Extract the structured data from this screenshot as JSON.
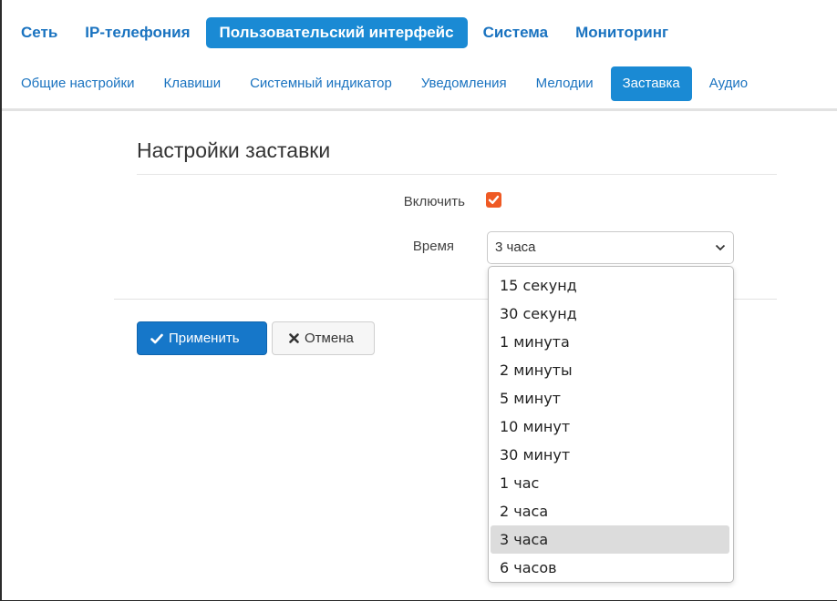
{
  "topnav": {
    "tabs": [
      {
        "label": "Сеть",
        "active": false
      },
      {
        "label": "IP-телефония",
        "active": false
      },
      {
        "label": "Пользовательский интерфейс",
        "active": true
      },
      {
        "label": "Система",
        "active": false
      },
      {
        "label": "Мониторинг",
        "active": false
      }
    ]
  },
  "subnav": {
    "tabs": [
      {
        "label": "Общие настройки",
        "active": false
      },
      {
        "label": "Клавиши",
        "active": false
      },
      {
        "label": "Системный индикатор",
        "active": false
      },
      {
        "label": "Уведомления",
        "active": false
      },
      {
        "label": "Мелодии",
        "active": false
      },
      {
        "label": "Заставка",
        "active": true
      },
      {
        "label": "Аудио",
        "active": false
      }
    ]
  },
  "section": {
    "title": "Настройки заставки"
  },
  "form": {
    "enable_label": "Включить",
    "enable_checked": true,
    "time_label": "Время",
    "time_value": "3 часа",
    "time_options": [
      "15 секунд",
      "30 секунд",
      "1 минута",
      "2 минуты",
      "5 минут",
      "10 минут",
      "30 минут",
      "1 час",
      "2 часа",
      "3 часа",
      "6 часов"
    ]
  },
  "buttons": {
    "apply_label": "Применить",
    "cancel_label": "Отмена"
  },
  "colors": {
    "accent": "#1a8ad4",
    "checkbox": "#ef5a24",
    "apply": "#1677c9"
  }
}
